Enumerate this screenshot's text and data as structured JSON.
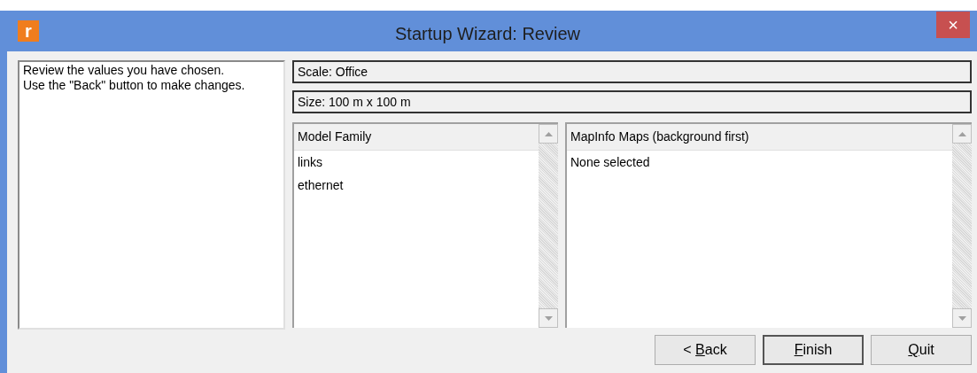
{
  "window": {
    "title": "Startup Wizard: Review",
    "app_icon_letter": "r",
    "close_symbol": "×"
  },
  "instructions": "Review the values you have chosen.\nUse the \"Back\" button to make changes.",
  "summary_fields": [
    "Scale: Office",
    "Size: 100 m x 100 m"
  ],
  "lists": [
    {
      "header": "Model Family",
      "items": [
        "links",
        "ethernet"
      ]
    },
    {
      "header": "MapInfo Maps (background first)",
      "items": [
        "None selected"
      ]
    }
  ],
  "buttons": [
    {
      "before": "< ",
      "key": "B",
      "after": "ack",
      "default": false
    },
    {
      "key": "F",
      "after": "inish",
      "default": true
    },
    {
      "key": "Q",
      "after": "uit",
      "default": false
    }
  ]
}
